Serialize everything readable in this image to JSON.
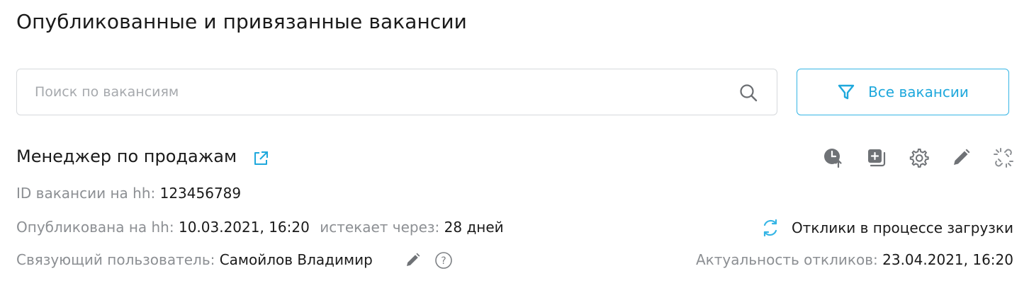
{
  "page": {
    "title": "Опубликованные и привязанные вакансии"
  },
  "search": {
    "placeholder": "Поиск по вакансиям",
    "value": ""
  },
  "filter": {
    "label": "Все вакансии",
    "accent_color": "#1ea8dc"
  },
  "vacancy": {
    "title": "Менеджер по продажам",
    "id_label": "ID вакансии на hh:",
    "id_value": "123456789",
    "published_label": "Опубликована на hh:",
    "published_value": "10.03.2021, 16:20",
    "expires_label": "истекает через:",
    "expires_value": "28 дней",
    "user_label": "Связующий пользователь:",
    "user_value": "Самойлов Владимир",
    "status_text": "Отклики в процессе загрузки",
    "actuality_label": "Актуальность откликов:",
    "actuality_value": "23.04.2021, 16:20",
    "actions": [
      "clock-up-icon",
      "add-copy-icon",
      "gear-icon",
      "pencil-icon",
      "unlink-icon"
    ]
  }
}
